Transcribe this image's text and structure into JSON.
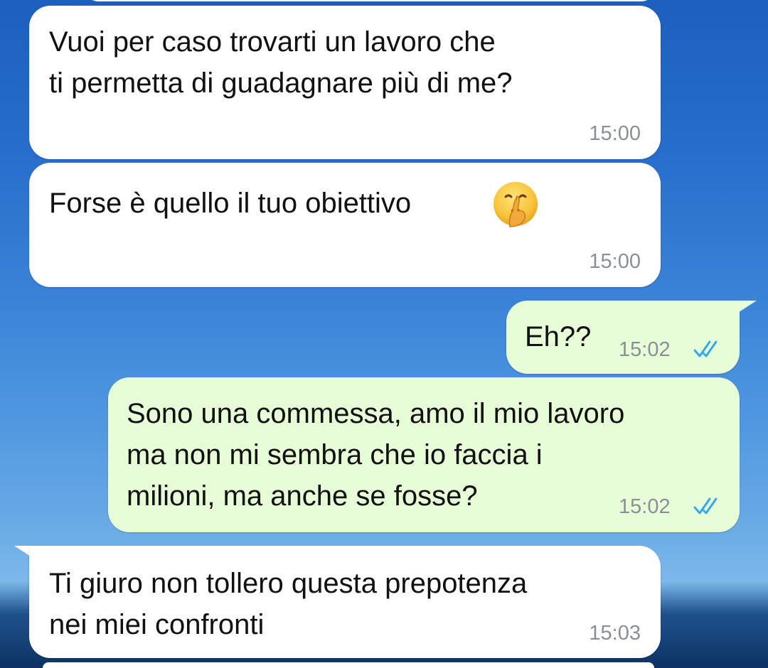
{
  "messages": [
    {
      "direction": "incoming",
      "text": "Vuoi per caso trovarti un lavoro che\nti permetta di guadagnare più di me?",
      "time": "15:00"
    },
    {
      "direction": "incoming",
      "text": "Forse è quello il tuo obiettivo",
      "emoji": "shushing-face-icon",
      "time": "15:00"
    },
    {
      "direction": "outgoing",
      "text": "Eh??",
      "time": "15:02",
      "status": "read-double-check-icon"
    },
    {
      "direction": "outgoing",
      "text": "Sono una commessa, amo il mio lavoro\nma non mi sembra che io faccia i\nmilioni, ma anche se fosse?",
      "time": "15:02",
      "status": "read-double-check-icon"
    },
    {
      "direction": "incoming",
      "text": "Ti giuro non tollero questa prepotenza\nnei miei confronti",
      "time": "15:03"
    }
  ],
  "colors": {
    "incoming_bubble": "#ffffff",
    "outgoing_bubble": "#e7fdd7",
    "timestamp": "#8a8f96",
    "read_ticks": "#34a9ef"
  }
}
